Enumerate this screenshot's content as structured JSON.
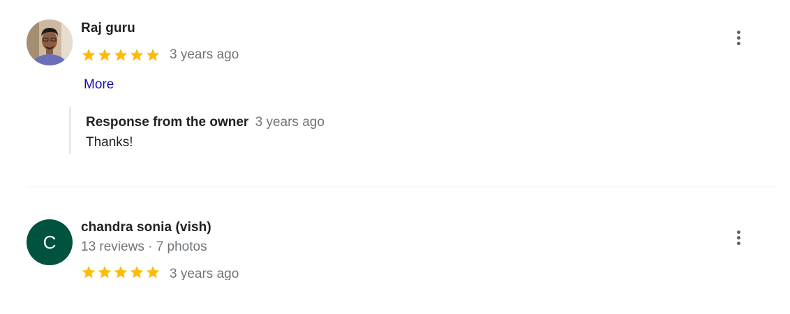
{
  "reviews": [
    {
      "author": "Raj guru",
      "rating": 5,
      "date": "3 years ago",
      "more_label": "More",
      "owner_response": {
        "label": "Response from the owner",
        "date": "3 years ago",
        "text": "Thanks!"
      }
    },
    {
      "author": "chandra sonia (vish)",
      "avatar_initial": "C",
      "avatar_color": "#01533f",
      "stats": "13 reviews · 7 photos",
      "rating": 5,
      "date": "3 years ago"
    }
  ],
  "colors": {
    "star": "#fbbc04",
    "link": "#1a0dab",
    "muted": "#70757a"
  },
  "icons": {
    "star": "star-icon",
    "menu": "more-vertical-icon"
  }
}
